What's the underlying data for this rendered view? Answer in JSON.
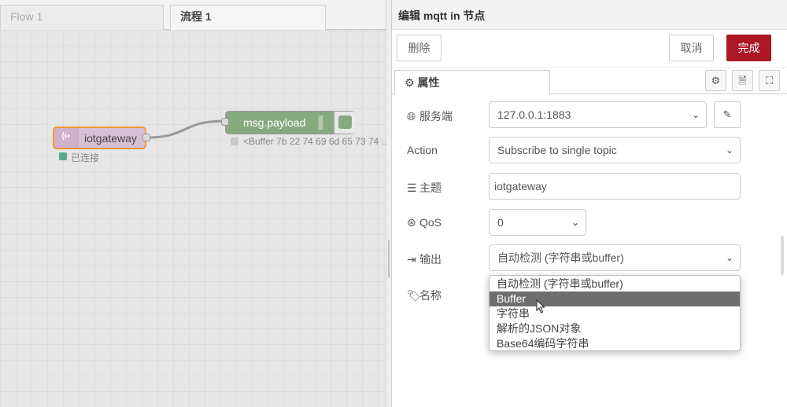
{
  "workspace": {
    "tabs": [
      {
        "label": "Flow 1",
        "active": false
      },
      {
        "label": "流程 1",
        "active": true
      }
    ],
    "nodes": {
      "mqtt_in": {
        "label": "iotgateway",
        "status": "已连接",
        "status_color": "#55aa88",
        "icon": "mqtt-wave-icon"
      },
      "debug": {
        "label": "msg.payload",
        "status": "<Buffer 7b 22 74 69 6d 65 73 74 ..."
      }
    }
  },
  "tray": {
    "title": "编辑 mqtt in 节点",
    "buttons": {
      "delete": "删除",
      "cancel": "取消",
      "done": "完成"
    },
    "done_color": "#ad1625",
    "tabs": {
      "properties": "属性"
    },
    "fields": {
      "server": {
        "label": "服务端",
        "value": "127.0.0.1:1883",
        "icon": "globe-icon"
      },
      "action": {
        "label": "Action",
        "value": "Subscribe to single topic"
      },
      "topic": {
        "label": "主题",
        "value": "iotgateway",
        "icon": "tasks-icon"
      },
      "qos": {
        "label": "QoS",
        "value": "0",
        "icon": "asterisk-icon"
      },
      "output": {
        "label": "输出",
        "value": "自动检测 (字符串或buffer)",
        "icon": "sign-out-icon"
      },
      "name": {
        "label": "名称",
        "icon": "tag-icon"
      }
    },
    "output_options": [
      "自动检测 (字符串或buffer)",
      "Buffer",
      "字符串",
      "解析的JSON对象",
      "Base64编码字符串"
    ],
    "highlighted_option": "Buffer"
  }
}
